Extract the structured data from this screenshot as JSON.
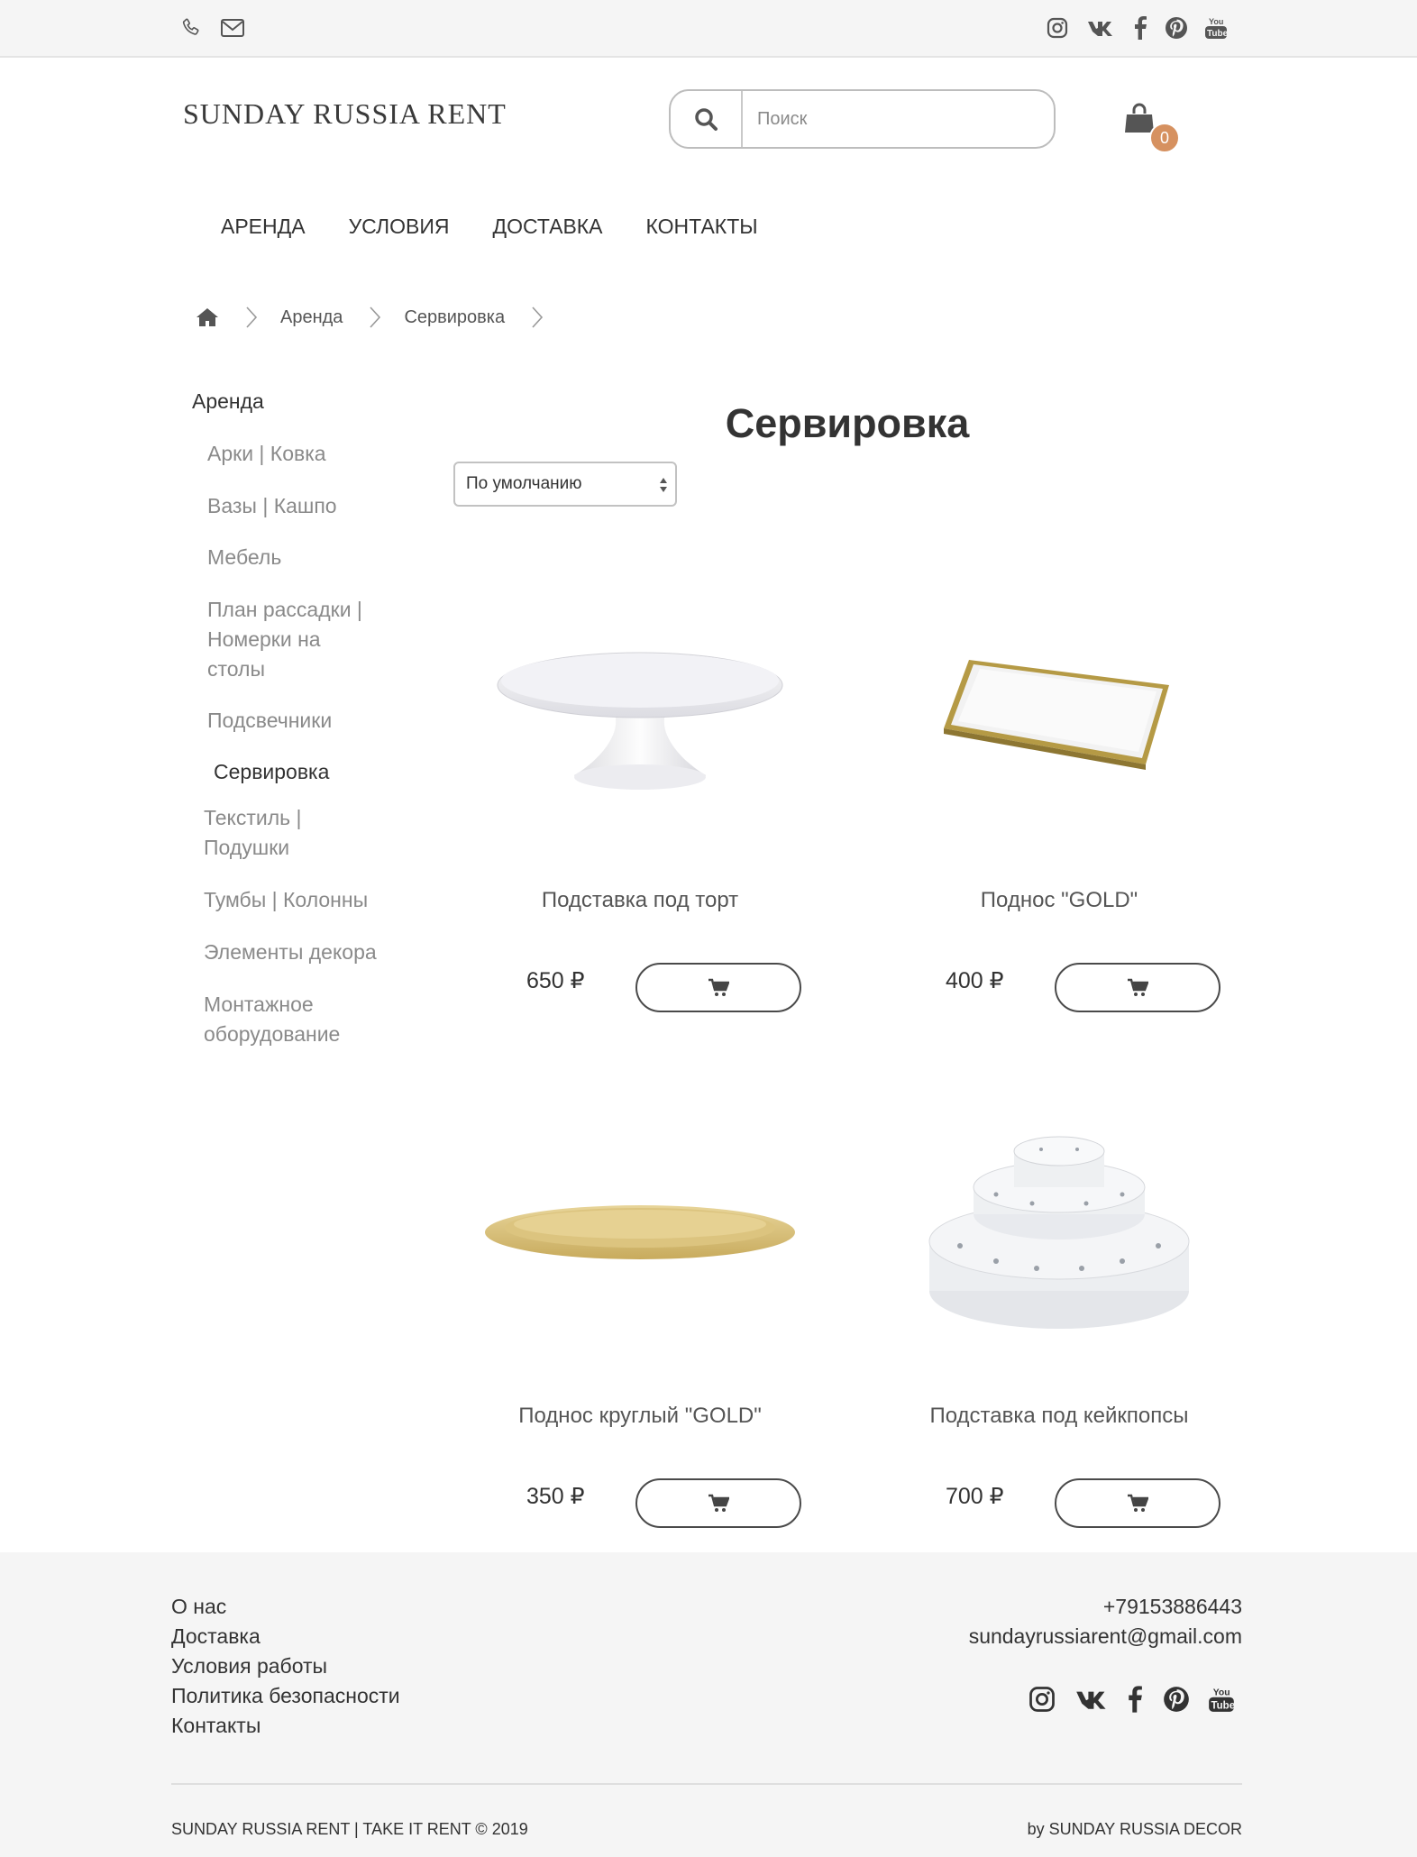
{
  "topbar": {
    "left_icons": [
      "phone-icon",
      "mail-icon"
    ],
    "social_icons": [
      "instagram-icon",
      "vk-icon",
      "facebook-icon",
      "pinterest-icon",
      "youtube-icon"
    ]
  },
  "header": {
    "logo": "SUNDAY RUSSIA RENT",
    "search_placeholder": "Поиск",
    "cart_count": "0"
  },
  "nav": [
    "АРЕНДА",
    "УСЛОВИЯ",
    "ДОСТАВКА",
    "КОНТАКТЫ"
  ],
  "breadcrumb": [
    "Аренда",
    "Сервировка"
  ],
  "sidebar": {
    "root": "Аренда",
    "items": [
      "Арки | Ковка",
      "Вазы | Кашпо",
      "Мебель",
      "План рассадки |\nНомерки на\nстолы",
      "Подсвечники",
      "Сервировка",
      "Текстиль |\nПодушки",
      "Тумбы | Колонны",
      "Элементы декора",
      "Монтажное\nоборудование"
    ],
    "active": "Сервировка"
  },
  "main": {
    "title": "Сервировка",
    "sort_selected": "По умолчанию",
    "products": [
      {
        "name": "Подставка под торт",
        "price": "650 ₽",
        "image": "cake-stand"
      },
      {
        "name": "Поднос \"GOLD\"",
        "price": "400 ₽",
        "image": "gold-tray"
      },
      {
        "name": "Поднос круглый \"GOLD\"",
        "price": "350 ₽",
        "image": "round-gold-tray"
      },
      {
        "name": "Подставка под кейкпопсы",
        "price": "700 ₽",
        "image": "cakepops-stand"
      }
    ]
  },
  "colors": {
    "accent": "#d69160",
    "topbar_bg": "#f5f5f5",
    "text": "#333333",
    "muted": "#8a8a8a",
    "gold": "#d4b56a"
  },
  "footer": {
    "links": [
      "О нас",
      "Доставка",
      "Условия работы",
      "Политика безопасности",
      "Контакты"
    ],
    "phone": "+79153886443",
    "email": "sundayrussiarent@gmail.com",
    "copyright": "SUNDAY RUSSIA RENT | TAKE IT RENT © 2019",
    "by": "by SUNDAY RUSSIA DECOR"
  }
}
